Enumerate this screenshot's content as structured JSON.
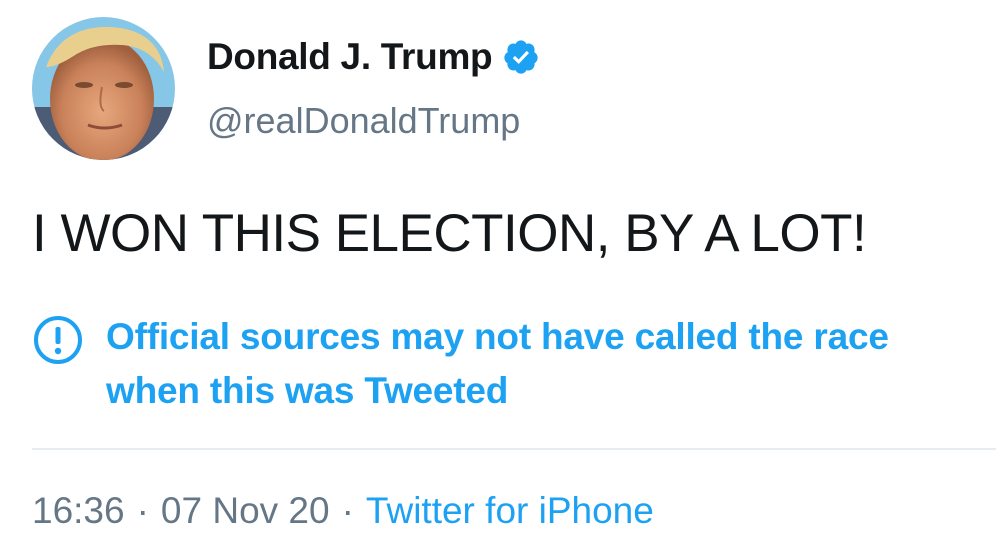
{
  "author": {
    "display_name": "Donald J. Trump",
    "handle": "@realDonaldTrump",
    "verified": true,
    "avatar_icon": "profile-photo"
  },
  "tweet": {
    "text": "I WON THIS ELECTION, BY A LOT!"
  },
  "label": {
    "icon": "exclamation-circle-icon",
    "text": "Official sources may not have called the race when this was Tweeted"
  },
  "meta": {
    "time": "16:36",
    "separator": "·",
    "date": "07 Nov 20",
    "source": "Twitter for iPhone"
  },
  "colors": {
    "text_primary": "#14171a",
    "text_secondary": "#657786",
    "accent": "#1da1f2",
    "divider": "#e6ecf0"
  }
}
